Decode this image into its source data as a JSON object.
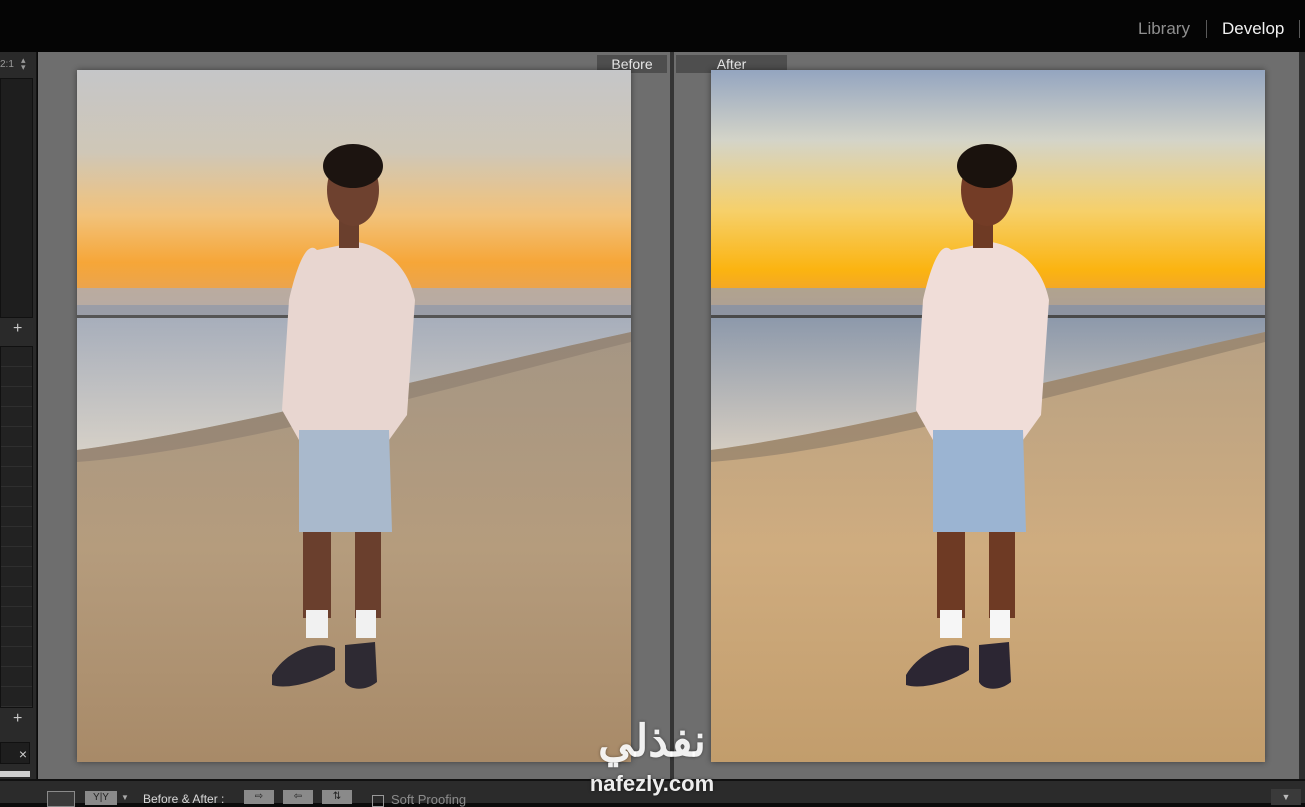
{
  "top_bar": {
    "modules": {
      "library": "Library",
      "develop": "Develop"
    },
    "active_module": "Develop"
  },
  "left_panel": {
    "zoom_value": "2:1",
    "add_icon": "plus-icon",
    "close_icon": "close-icon",
    "close_glyph": "×",
    "plus_glyph": "+"
  },
  "main": {
    "before_label": "Before",
    "after_label": "After"
  },
  "bottom_toolbar": {
    "view_mode_label": "Y|Y",
    "before_after_label": "Before & After :",
    "copy_before_to_after": "⇨",
    "copy_after_to_before": "⇦",
    "swap": "⇅",
    "soft_proofing_label": "Soft Proofing",
    "soft_proofing_checked": false,
    "menu_icon": "chevron-down-icon"
  },
  "watermark": {
    "arabic": "نفذلي",
    "latin": "nafezly.com"
  },
  "colors": {
    "main_background": "#6e6e6e",
    "active_module_text": "#f2f2f2",
    "inactive_module_text": "#8f8f8f"
  }
}
